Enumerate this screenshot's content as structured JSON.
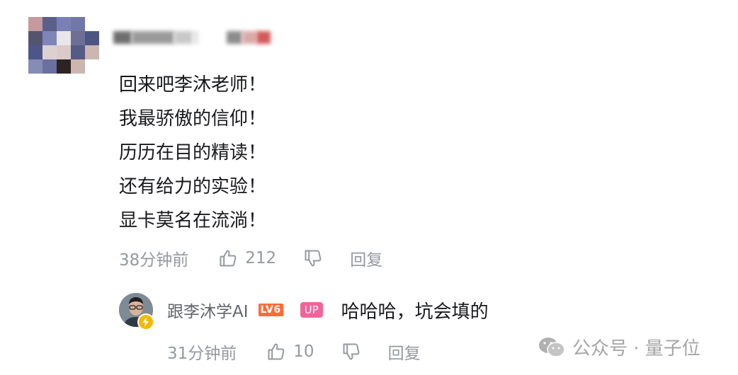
{
  "comment": {
    "lines": [
      "回来吧李沐老师！",
      "我最骄傲的信仰！",
      "历历在目的精读！",
      "还有给力的实验！",
      "显卡莫名在流淌！"
    ],
    "time": "38分钟前",
    "likes": "212",
    "reply_label": "回复"
  },
  "reply": {
    "username": "跟李沐学AI",
    "level": "LV6",
    "up_badge": "UP",
    "text": "哈哈哈，坑会填的",
    "time": "31分钟前",
    "likes": "10",
    "reply_label": "回复"
  },
  "watermark": {
    "text": "公众号 · 量子位",
    "icon": "wechat-icon"
  },
  "colors": {
    "meta_gray": "#9499a0",
    "level_orange": "#ff6b37",
    "up_pink": "#f0649b",
    "bolt_yellow": "#f5b800"
  }
}
